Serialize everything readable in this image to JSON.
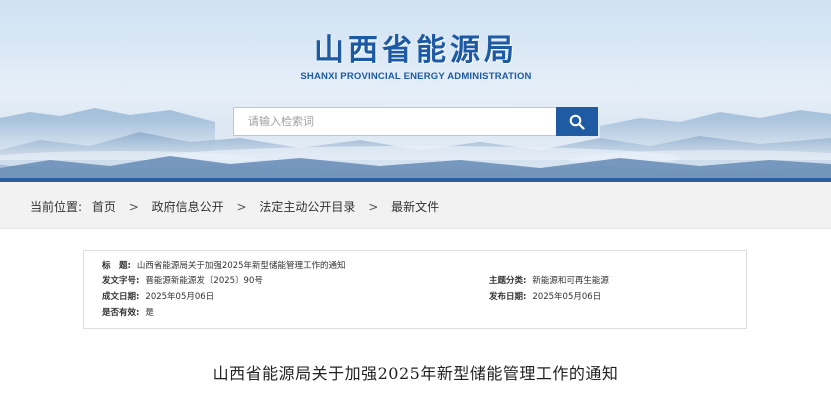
{
  "header": {
    "logo_cn": "山西省能源局",
    "logo_en": "SHANXI PROVINCIAL ENERGY ADMINISTRATION",
    "search_placeholder": "请输入检索词",
    "search_icon": "search-icon"
  },
  "breadcrumb": {
    "prefix": "当前位置:",
    "items": [
      "首页",
      "政府信息公开",
      "法定主动公开目录",
      "最新文件"
    ],
    "separator": ">"
  },
  "info": {
    "title_label": "标　题:",
    "title_value": "山西省能源局关于加强2025年新型储能管理工作的通知",
    "doc_no_label": "发文字号:",
    "doc_no_value": "晋能源新能源发〔2025〕90号",
    "created_label": "成文日期:",
    "created_value": "2025年05月06日",
    "valid_label": "是否有效:",
    "valid_value": "是",
    "topic_label": "主题分类:",
    "topic_value": "新能源和可再生能源",
    "published_label": "发布日期:",
    "published_value": "2025年05月06日"
  },
  "article": {
    "title": "山西省能源局关于加强2025年新型储能管理工作的通知"
  },
  "colors": {
    "brand_blue": "#1f5ba3",
    "stripe": "#2a5f9e",
    "crumb_bg": "#f2f2f2"
  }
}
